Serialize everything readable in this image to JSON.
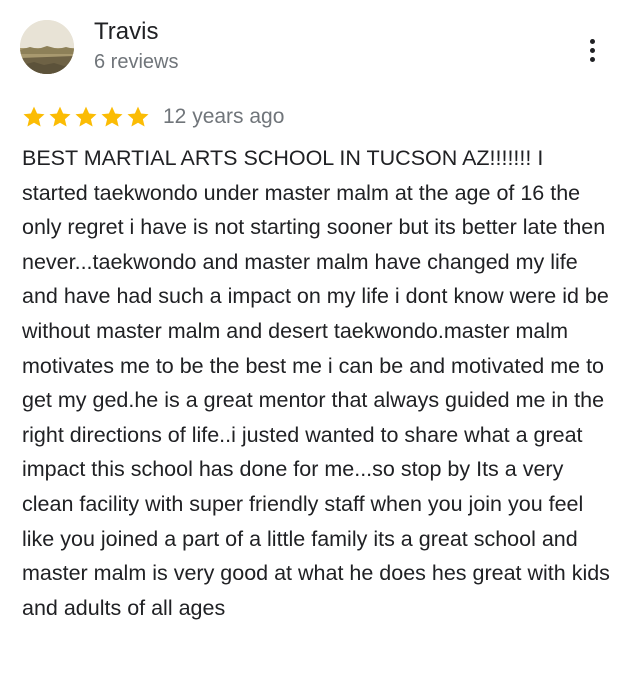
{
  "review": {
    "author": {
      "name": "Travis",
      "meta": "6 reviews",
      "avatar_icon": "landscape-photo-avatar"
    },
    "menu_icon": "more-vertical-icon",
    "rating": {
      "value": 5,
      "max": 5,
      "star_color": "#fbbc04"
    },
    "time": "12 years ago",
    "text": "BEST MARTIAL ARTS SCHOOL IN TUCSON AZ!!!!!!! I started taekwondo under master malm at the age of 16 the only regret i have is not starting sooner but its better late then never...taekwondo and master malm have changed my life and have had such a impact on my life i dont know were id be without master malm and desert taekwondo.master malm motivates me to be the best me i can be and motivated me to get my ged.he is a great mentor that always guided me in the right directions of life..i justed wanted to share what a great impact this school has done for me...so stop by Its a very clean facility with super friendly staff when you join you feel like you joined a part of a little family its a great school and master malm is very good at what he does hes great with kids and adults of all ages"
  }
}
